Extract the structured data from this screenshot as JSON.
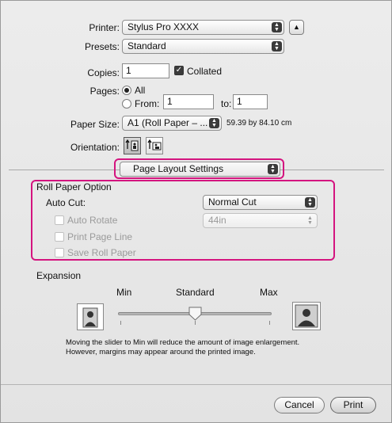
{
  "printer": {
    "label": "Printer:",
    "value": "Stylus Pro XXXX"
  },
  "presets": {
    "label": "Presets:",
    "value": "Standard"
  },
  "copies": {
    "label": "Copies:",
    "value": "1",
    "collated_label": "Collated",
    "collated_checked": true
  },
  "pages": {
    "label": "Pages:",
    "all_label": "All",
    "from_label": "From:",
    "from_value": "1",
    "to_label": "to:",
    "to_value": "1"
  },
  "paper_size": {
    "label": "Paper Size:",
    "value": "A1 (Roll Paper – ...",
    "dimensions": "59.39 by 84.10 cm"
  },
  "orientation": {
    "label": "Orientation:"
  },
  "panel_select": {
    "value": "Page Layout Settings"
  },
  "roll_paper": {
    "title": "Roll Paper Option",
    "auto_cut_label": "Auto Cut:",
    "auto_cut_value": "Normal Cut",
    "auto_rotate_label": "Auto Rotate",
    "auto_rotate_value": "44in",
    "print_page_line_label": "Print Page Line",
    "save_roll_paper_label": "Save Roll Paper"
  },
  "expansion": {
    "title": "Expansion",
    "min_label": "Min",
    "standard_label": "Standard",
    "max_label": "Max",
    "slider_value": "Standard",
    "note_line1": "Moving the slider to Min will reduce the amount of image enlargement.",
    "note_line2": "However, margins may appear around the printed image."
  },
  "buttons": {
    "cancel": "Cancel",
    "print": "Print"
  },
  "colors": {
    "highlight": "#d4147f"
  }
}
